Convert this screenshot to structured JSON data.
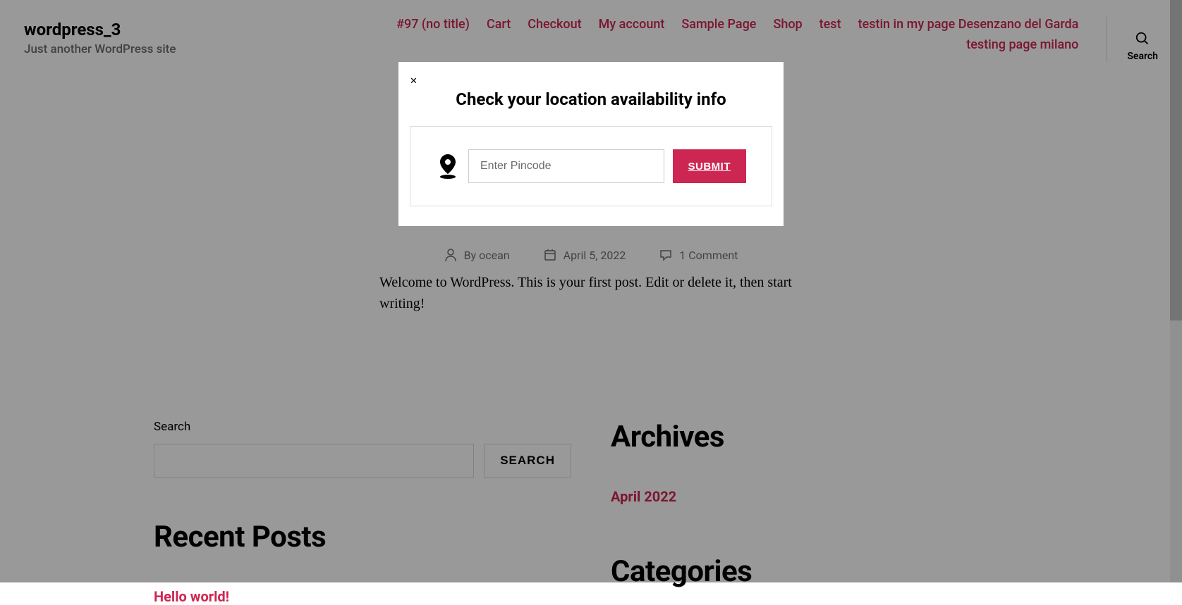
{
  "site": {
    "title": "wordpress_3",
    "tagline": "Just another WordPress site"
  },
  "nav": {
    "row1": [
      "#97 (no title)",
      "Cart",
      "Checkout",
      "My account",
      "Sample Page",
      "Shop",
      "test",
      "testin in my page Desenzano del Garda"
    ],
    "row2": [
      "testing page milano"
    ]
  },
  "search": {
    "label": "Search"
  },
  "modal": {
    "title": "Check your location availability info",
    "placeholder": "Enter Pincode",
    "submit": "SUBMIT",
    "close": "✕"
  },
  "post": {
    "meta": {
      "by_label": "By",
      "author": "ocean",
      "date": "April 5, 2022",
      "comments": "1 Comment"
    },
    "body": "Welcome to WordPress. This is your first post. Edit or delete it, then start writing!"
  },
  "widgets": {
    "search_label": "Search",
    "search_button": "SEARCH",
    "recent_title": "Recent Posts",
    "recent_link": "Hello world!",
    "archives_title": "Archives",
    "archives_link": "April 2022",
    "categories_title": "Categories"
  }
}
